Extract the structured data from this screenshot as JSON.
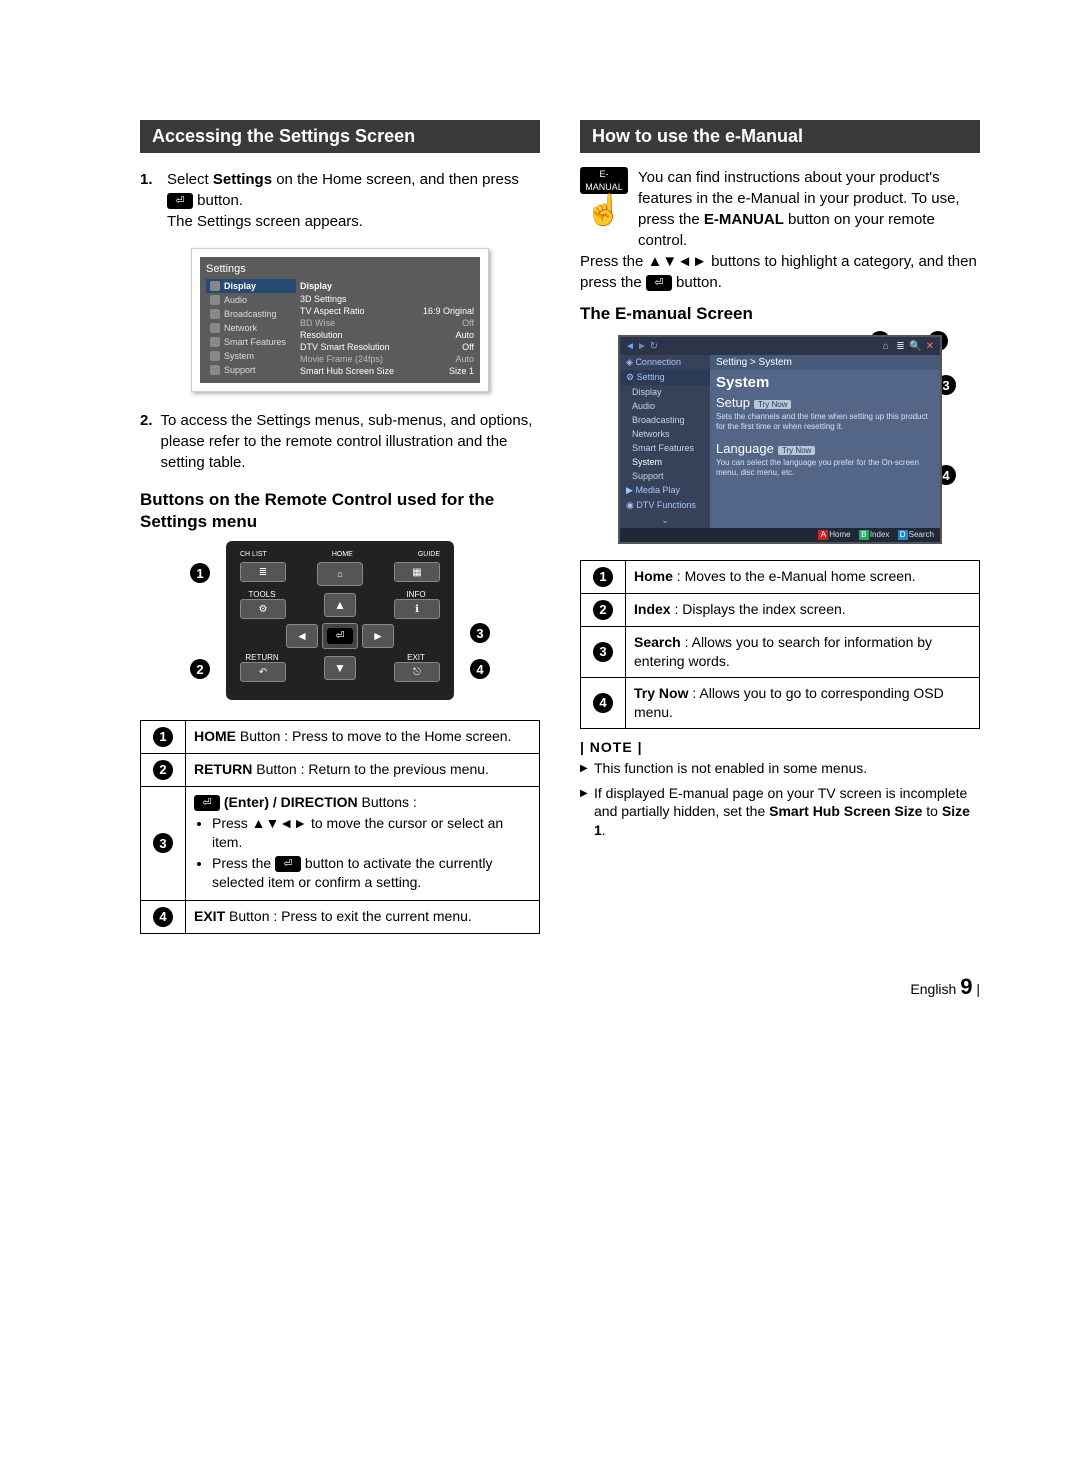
{
  "left": {
    "title": "Accessing the Settings Screen",
    "steps": [
      {
        "n": "1.",
        "pre": "Select ",
        "bold": "Settings",
        "mid": " on the Home screen, and then press ",
        "after": " button.",
        "line2": "The Settings screen appears."
      },
      {
        "n": "2.",
        "text": "To access the Settings menus, sub-menus, and options, please refer to the remote control illustration and the setting table."
      }
    ],
    "settings_panel": {
      "title": "Settings",
      "side": [
        "Display",
        "Audio",
        "Broadcasting",
        "Network",
        "Smart Features",
        "System",
        "Support"
      ],
      "main_header": "Display",
      "rows": [
        {
          "k": "3D Settings",
          "v": ""
        },
        {
          "k": "TV Aspect Ratio",
          "v": "16:9 Original"
        },
        {
          "k": "BD Wise",
          "v": "Off"
        },
        {
          "k": "Resolution",
          "v": "Auto"
        },
        {
          "k": "DTV Smart Resolution",
          "v": "Off"
        },
        {
          "k": "Movie Frame (24fps)",
          "v": "Auto"
        },
        {
          "k": "Smart Hub Screen Size",
          "v": "Size 1"
        }
      ]
    },
    "sub_heading": "Buttons on the Remote Control used for the Settings menu",
    "remote": {
      "top": [
        "CH LIST",
        "HOME",
        "GUIDE"
      ],
      "mid_left": "TOOLS",
      "mid_right": "INFO",
      "bottom_left": "RETURN",
      "bottom_right": "EXIT"
    },
    "callouts": [
      "1",
      "2",
      "3",
      "4"
    ],
    "table": [
      {
        "n": "1",
        "bold": "HOME",
        "rest": " Button : Press to move to the Home screen."
      },
      {
        "n": "2",
        "bold": "RETURN",
        "rest": " Button : Return to the previous menu."
      },
      {
        "n": "3",
        "title_bold": " (Enter) / DIRECTION",
        "title_rest": " Buttons :",
        "b1_pre": "Press ▲▼◄► to move the cursor or select an item.",
        "b2_pre": "Press the ",
        "b2_post": " button to activate the currently selected item or confirm a setting."
      },
      {
        "n": "4",
        "bold": "EXIT",
        "rest": " Button : Press to exit the current menu."
      }
    ]
  },
  "right": {
    "title": "How to use the e-Manual",
    "emanual_label": "E-MANUAL",
    "intro": {
      "p1a": "You can find instructions about your product's features in the e-Manual in your product. To use, press the ",
      "p1b": "E-MANUAL",
      "p1c": " button on your remote control.",
      "p2a": "Press the ▲▼◄► buttons to highlight a category, and then press the ",
      "p2b": " button."
    },
    "sub_heading": "The E-manual Screen",
    "screen": {
      "crumb": "Setting > System",
      "side_cats": [
        "Connection",
        "Setting"
      ],
      "side_subs": [
        "Display",
        "Audio",
        "Broadcasting",
        "Networks",
        "Smart Features",
        "System",
        "Support"
      ],
      "side_cats2": [
        "Media Play",
        "DTV Functions"
      ],
      "h1": "System",
      "opt1": "Setup",
      "try": "Try Now",
      "desc": "Sets the channels and the time when setting up this product for the first time or when resetting it.",
      "opt2": "Language",
      "desc2": "You can select the language you prefer for the On-screen menu, disc menu, etc.",
      "foot": {
        "a": "Home",
        "b": "Index",
        "c": "Search"
      }
    },
    "callouts": [
      "1",
      "2",
      "3",
      "4"
    ],
    "table": [
      {
        "n": "1",
        "bold": "Home",
        "rest": " : Moves to the e-Manual home screen."
      },
      {
        "n": "2",
        "bold": "Index",
        "rest": " : Displays the index screen."
      },
      {
        "n": "3",
        "bold": "Search",
        "rest": " : Allows you to search for information by entering words."
      },
      {
        "n": "4",
        "bold": "Try Now",
        "rest": " : Allows you to go to corresponding OSD menu."
      }
    ],
    "note_hd": "| NOTE |",
    "notes": [
      "This function is not enabled in some menus.",
      {
        "pre": "If displayed E-manual page on your TV screen is incomplete and partially hidden, set the ",
        "b1": "Smart Hub Screen Size",
        "mid": " to ",
        "b2": "Size 1",
        "post": "."
      }
    ]
  },
  "footer": {
    "lang": "English",
    "page": "9"
  }
}
